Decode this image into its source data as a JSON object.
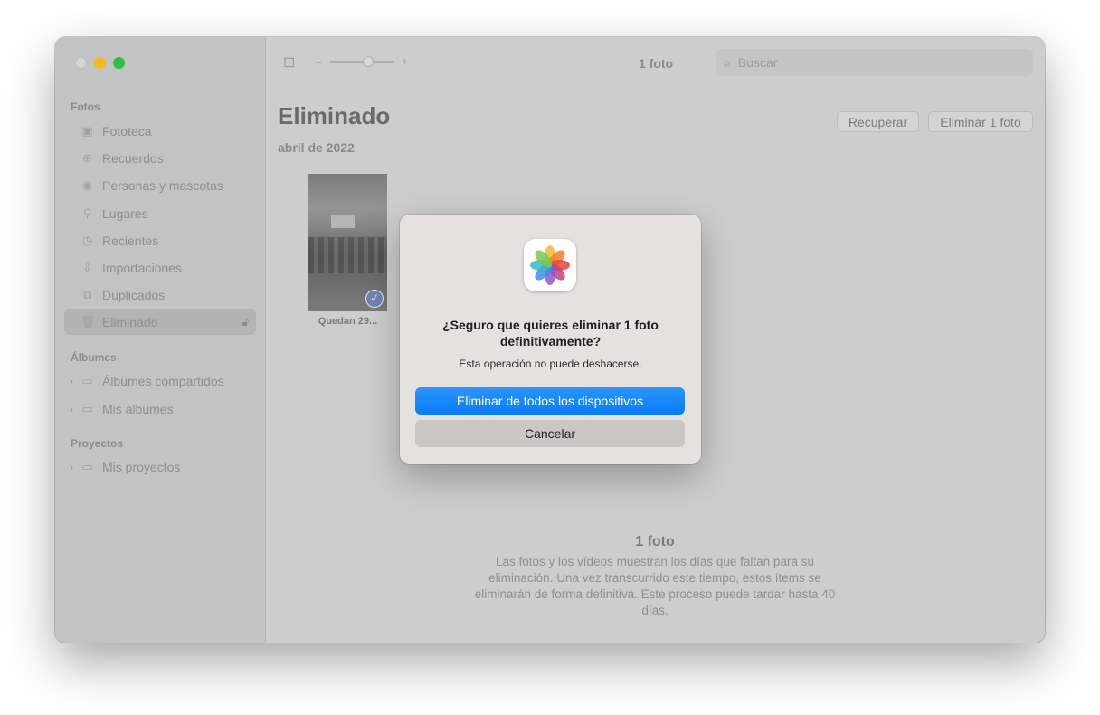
{
  "sidebar": {
    "sections": [
      {
        "label": "Fotos"
      },
      {
        "label": "Álbumes"
      },
      {
        "label": "Proyectos"
      }
    ],
    "items": [
      {
        "label": "Fototeca",
        "icon": "photo-library-icon"
      },
      {
        "label": "Recuerdos",
        "icon": "memories-icon"
      },
      {
        "label": "Personas y mascotas",
        "icon": "person-icon"
      },
      {
        "label": "Lugares",
        "icon": "pin-icon"
      },
      {
        "label": "Recientes",
        "icon": "clock-icon"
      },
      {
        "label": "Importaciones",
        "icon": "import-icon"
      },
      {
        "label": "Duplicados",
        "icon": "duplicates-icon"
      },
      {
        "label": "Eliminado",
        "icon": "trash-icon",
        "selected": true
      },
      {
        "label": "Álbumes compartidos",
        "icon": "shared-album-icon"
      },
      {
        "label": "Mis álbumes",
        "icon": "album-icon"
      },
      {
        "label": "Mis proyectos",
        "icon": "project-icon"
      }
    ]
  },
  "toolbar": {
    "count": "1 foto",
    "zoom_minus": "–",
    "zoom_plus": "+",
    "zoom_level": 0.62,
    "search_placeholder": "Buscar"
  },
  "main": {
    "title": "Eliminado",
    "date": "abril de 2022",
    "recover_label": "Recuperar",
    "delete_label": "Eliminar 1 foto",
    "thumb_caption": "Quedan 29...",
    "footer_count": "1 foto",
    "footer_text": "Las fotos y los vídeos muestran los días que faltan para su eliminación. Una vez transcurrido este tiempo, estos ítems se eliminarán de forma definitiva. Este proceso puede tardar hasta 40 días."
  },
  "dialog": {
    "title": "¿Seguro que quieres eliminar 1 foto definitivamente?",
    "message": "Esta operación no puede deshacerse.",
    "primary_label": "Eliminar de todos los dispositivos",
    "secondary_label": "Cancelar"
  },
  "colors": {
    "accent": "#0a7cf6",
    "traffic_min": "#f6b81d",
    "traffic_max": "#2fbf45"
  }
}
